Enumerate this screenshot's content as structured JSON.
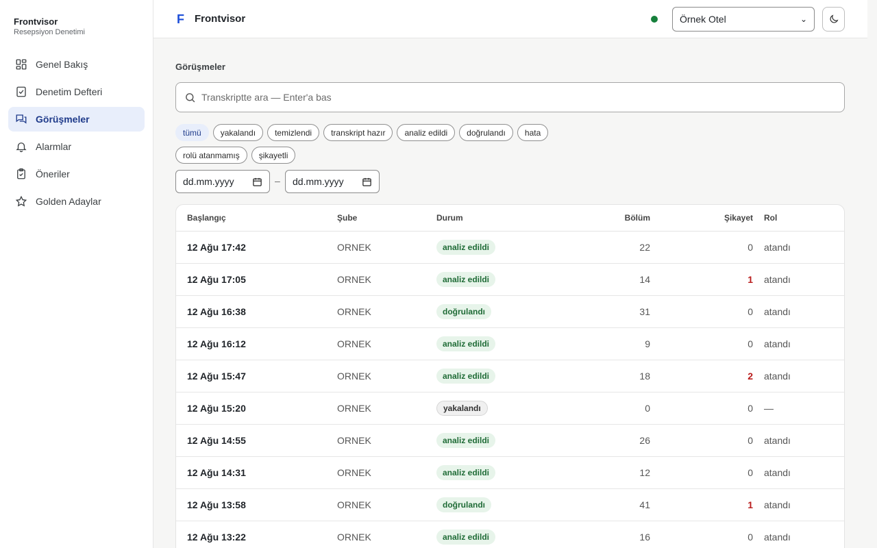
{
  "sidebar": {
    "brand_title": "Frontvisor",
    "brand_subtitle": "Resepsiyon Denetimi",
    "items": [
      {
        "label": "Genel Bakış",
        "icon": "dashboard-icon",
        "active": false
      },
      {
        "label": "Denetim Defteri",
        "icon": "checkbook-icon",
        "active": false
      },
      {
        "label": "Görüşmeler",
        "icon": "chat-icon",
        "active": true
      },
      {
        "label": "Alarmlar",
        "icon": "bell-icon",
        "active": false
      },
      {
        "label": "Öneriler",
        "icon": "clipboard-check-icon",
        "active": false
      },
      {
        "label": "Golden Adaylar",
        "icon": "star-icon",
        "active": false
      }
    ]
  },
  "header": {
    "logo_letter": "F",
    "app_name": "Frontvisor",
    "status_color": "#16803c",
    "hotel_select_value": "Örnek Otel",
    "theme_icon": "moon-icon"
  },
  "main": {
    "section_title": "Görüşmeler",
    "search_placeholder": "Transkriptte ara — Enter'a bas",
    "filters": [
      "tümü",
      "yakalandı",
      "temizlendi",
      "transkript hazır",
      "analiz edildi",
      "doğrulandı",
      "hata",
      "rolü atanmamış",
      "şikayetli"
    ],
    "active_filter": "tümü",
    "date_from_placeholder": "dd.mm.yyyy",
    "date_to_placeholder": "dd.mm.yyyy",
    "date_separator": "–",
    "table": {
      "headers": [
        "Başlangıç",
        "Şube",
        "Durum",
        "Bölüm",
        "Şikayet",
        "Rol"
      ],
      "rows": [
        {
          "start": "12 Ağu 17:42",
          "branch": "ORNEK",
          "status": "analiz edildi",
          "sections": "22",
          "complaints": "0",
          "role": "atandı"
        },
        {
          "start": "12 Ağu 17:05",
          "branch": "ORNEK",
          "status": "analiz edildi",
          "sections": "14",
          "complaints": "1",
          "role": "atandı"
        },
        {
          "start": "12 Ağu 16:38",
          "branch": "ORNEK",
          "status": "doğrulandı",
          "sections": "31",
          "complaints": "0",
          "role": "atandı"
        },
        {
          "start": "12 Ağu 16:12",
          "branch": "ORNEK",
          "status": "analiz edildi",
          "sections": "9",
          "complaints": "0",
          "role": "atandı"
        },
        {
          "start": "12 Ağu 15:47",
          "branch": "ORNEK",
          "status": "analiz edildi",
          "sections": "18",
          "complaints": "2",
          "role": "atandı"
        },
        {
          "start": "12 Ağu 15:20",
          "branch": "ORNEK",
          "status": "yakalandı",
          "sections": "0",
          "complaints": "0",
          "role": "—"
        },
        {
          "start": "12 Ağu 14:55",
          "branch": "ORNEK",
          "status": "analiz edildi",
          "sections": "26",
          "complaints": "0",
          "role": "atandı"
        },
        {
          "start": "12 Ağu 14:31",
          "branch": "ORNEK",
          "status": "analiz edildi",
          "sections": "12",
          "complaints": "0",
          "role": "atandı"
        },
        {
          "start": "12 Ağu 13:58",
          "branch": "ORNEK",
          "status": "doğrulandı",
          "sections": "41",
          "complaints": "1",
          "role": "atandı"
        },
        {
          "start": "12 Ağu 13:22",
          "branch": "ORNEK",
          "status": "analiz edildi",
          "sections": "16",
          "complaints": "0",
          "role": "atandı"
        }
      ]
    }
  }
}
